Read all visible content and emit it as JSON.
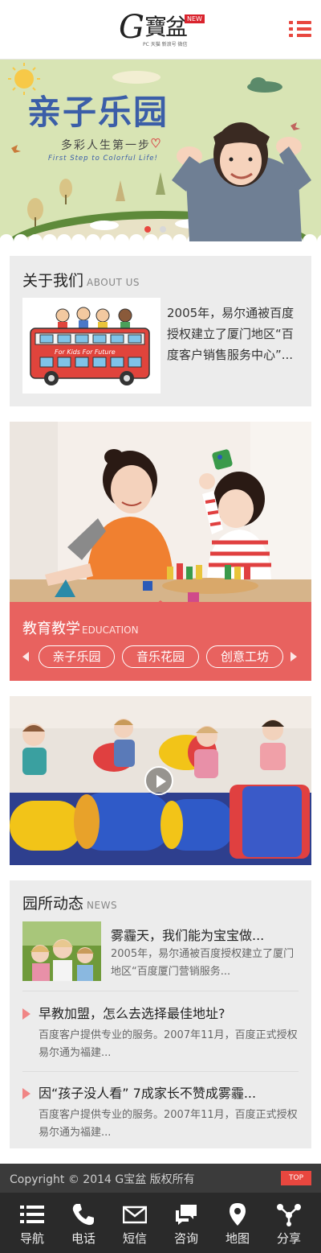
{
  "header": {
    "logo_letter": "G",
    "logo_name": "寶盆",
    "logo_badge": "NEW",
    "logo_tagline": "PC 天猫 新浪号 微信"
  },
  "banner": {
    "title": "亲子乐园",
    "subtitle": "多彩人生第一步",
    "subtitle_en": "First Step to Colorful Life!",
    "slide_count": 2,
    "active_slide": 1,
    "active_dot_color": "#e8473f",
    "dot_color": "#d8d8d8"
  },
  "about": {
    "title": "关于我们",
    "title_en": "ABOUT US",
    "image_caption": "For Kids For Future",
    "text": "2005年，易尔通被百度授权建立了厦门地区“百度客户销售服务中心”..."
  },
  "education": {
    "title": "教育教学",
    "title_en": "EDUCATION",
    "tabs": [
      "亲子乐园",
      "音乐花园",
      "创意工坊"
    ],
    "accent_color": "#e8625f"
  },
  "news": {
    "title": "园所动态",
    "title_en": "NEWS",
    "featured": {
      "title": "雾霾天，我们能为宝宝做...",
      "desc": "2005年，易尔通被百度授权建立了厦门地区“百度厦门营销服务..."
    },
    "items": [
      {
        "title": "早教加盟，怎么去选择最佳地址?",
        "desc": "百度客户提供专业的服务。2007年11月，百度正式授权易尔通为福建..."
      },
      {
        "title": "因“孩子没人看” 7成家长不赞成雾霾...",
        "desc": "百度客户提供专业的服务。2007年11月，百度正式授权易尔通为福建..."
      }
    ]
  },
  "footer": {
    "copyright": "Copyright © 2014 G宝盆 版权所有",
    "top_label": "TOP"
  },
  "bottom_nav": [
    {
      "label": "导航",
      "icon": "menu-icon"
    },
    {
      "label": "电话",
      "icon": "phone-icon"
    },
    {
      "label": "短信",
      "icon": "mail-icon"
    },
    {
      "label": "咨询",
      "icon": "chat-icon"
    },
    {
      "label": "地图",
      "icon": "map-pin-icon"
    },
    {
      "label": "分享",
      "icon": "share-icon"
    }
  ]
}
